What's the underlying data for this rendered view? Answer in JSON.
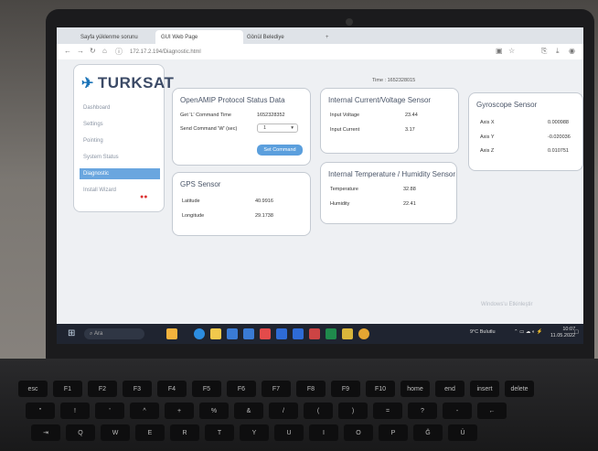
{
  "browser": {
    "tabs": [
      {
        "label": "Sayfa yüklenme sorunu"
      },
      {
        "label": "GUI Web Page"
      },
      {
        "label": "Gönül Belediye"
      }
    ],
    "url": "172.17.2.194/Diagnostic.html"
  },
  "header": {
    "time_label": "Time : 1652328015"
  },
  "brand": {
    "name": "TURKSAT",
    "accent": "#1a73b8"
  },
  "sidebar": {
    "items": [
      {
        "label": "Dashboard"
      },
      {
        "label": "Settings"
      },
      {
        "label": "Pointing"
      },
      {
        "label": "System Status"
      },
      {
        "label": "Diagnostic"
      },
      {
        "label": "Install Wizard"
      }
    ],
    "active_index": 4
  },
  "openamip": {
    "title": "OpenAMIP Protocol Status Data",
    "cmd_time_label": "Get 'L' Command Time",
    "cmd_time_value": "1652328352",
    "send_label": "Send Command 'W' (sec)",
    "select_value": "1",
    "button_label": "Set Command"
  },
  "gps": {
    "title": "GPS Sensor",
    "latitude_label": "Latitude",
    "latitude_value": "40.9916",
    "longitude_label": "Longitude",
    "longitude_value": "29.1738"
  },
  "current": {
    "title": "Internal Current/Voltage Sensor",
    "voltage_label": "Input Voltage",
    "voltage_value": "23.44",
    "current_label": "Input Current",
    "current_value": "3.17"
  },
  "temperature": {
    "title": "Internal Temperature / Humidity Sensor",
    "temp_label": "Temperature",
    "temp_value": "32.88",
    "hum_label": "Humidity",
    "hum_value": "22.41"
  },
  "gyro": {
    "title": "Gyroscope Sensor",
    "x_label": "Axis X",
    "x_value": "0.000988",
    "y_label": "Axis Y",
    "y_value": "-0.020036",
    "z_label": "Axis Z",
    "z_value": "0.010751"
  },
  "taskbar": {
    "search_placeholder": "Ara",
    "weather": "9°C Bulutlu",
    "clock_time": "10:07",
    "clock_date": "11.05.2022",
    "watermark": "Windows'u Etkinleştir"
  },
  "keyboard": {
    "row1": [
      "esc",
      "F1",
      "F2",
      "F3",
      "F4",
      "F5",
      "F6",
      "F7",
      "F8",
      "F9",
      "F10",
      "home",
      "end",
      "insert",
      "delete"
    ],
    "row2": [
      "\"",
      "!",
      "'",
      "^",
      "+",
      "%",
      "&",
      "/",
      "(",
      ")",
      "=",
      "?",
      "-",
      "←"
    ],
    "row3": [
      "⇥",
      "Q",
      "W",
      "E",
      "R",
      "T",
      "Y",
      "U",
      "I",
      "O",
      "P",
      "Ğ",
      "Ü"
    ]
  }
}
